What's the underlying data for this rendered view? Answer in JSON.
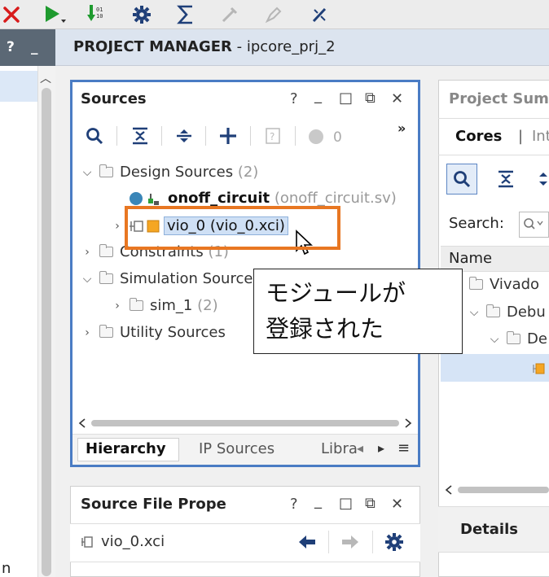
{
  "toolbar": {
    "icons": [
      "close-x-icon",
      "run-icon",
      "download-icon",
      "gear-icon",
      "sigma-icon",
      "disabled-tool-icon",
      "disabled-pen-icon",
      "debug-icon"
    ]
  },
  "left_panel": {
    "help": "?",
    "minimize": "_",
    "fragment": "n"
  },
  "project_manager": {
    "label": "PROJECT MANAGER",
    "separator": " - ",
    "project": "ipcore_prj_2"
  },
  "sources": {
    "title": "Sources",
    "controls": {
      "help": "?",
      "minimize": "_",
      "maximize": "□",
      "float": "⧉",
      "close": "✕"
    },
    "toolbar": {
      "overflow": "»",
      "count": "0"
    },
    "tree": {
      "design_sources": {
        "label": "Design Sources",
        "count": "(2)"
      },
      "onoff": {
        "label": "onoff_circuit",
        "detail": "(onoff_circuit.sv)"
      },
      "vio": {
        "label": "vio_0 (vio_0.xci)"
      },
      "constraints": {
        "label": "Constraints",
        "count": "(1)"
      },
      "simulation": {
        "label": "Simulation Sources"
      },
      "sim_1": {
        "label": "sim_1",
        "count": "(2)"
      },
      "utility": {
        "label": "Utility Sources"
      }
    },
    "tabs": [
      {
        "label": "Hierarchy",
        "active": true
      },
      {
        "label": "IP Sources",
        "active": false
      },
      {
        "label": "Libra",
        "active": false
      }
    ]
  },
  "properties": {
    "title": "Source File Prope",
    "controls": {
      "help": "?",
      "minimize": "_",
      "maximize": "□",
      "float": "⧉",
      "close": "✕"
    },
    "file": "vio_0.xci"
  },
  "summary": {
    "title": "Project Sum",
    "tabs": {
      "cores": "Cores",
      "divider": "|",
      "next": "Int"
    },
    "search_label": "Search:",
    "column_name": "Name",
    "rows": [
      "Vivado",
      "Debu",
      "De"
    ],
    "details": "Details"
  },
  "callout": {
    "text": "モジュールが\n登録された"
  },
  "colors": {
    "accent_blue": "#4a7cc4",
    "highlight_orange": "#e87722",
    "selection": "#cfe0f5"
  }
}
